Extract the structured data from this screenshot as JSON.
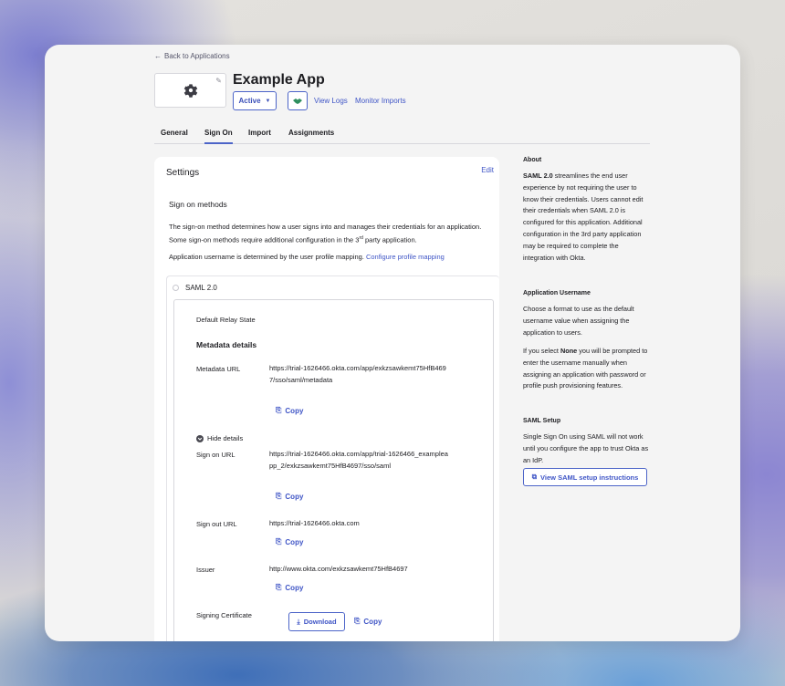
{
  "nav": {
    "back_label": "Back to Applications"
  },
  "app": {
    "title": "Example App",
    "status": "Active"
  },
  "header_links": {
    "view_logs": "View Logs",
    "monitor_imports": "Monitor Imports"
  },
  "tabs": [
    {
      "label": "General"
    },
    {
      "label": "Sign On",
      "active": true
    },
    {
      "label": "Import"
    },
    {
      "label": "Assignments"
    }
  ],
  "settings": {
    "title": "Settings",
    "edit_label": "Edit",
    "sign_on_heading": "Sign on methods",
    "para1_a": "The sign-on method determines how a user signs into and manages their credentials for an application. Some sign-on methods require additional configuration in the 3",
    "para1_sup": "rd",
    "para1_b": " party application.",
    "para2": "Application username is determined by the user profile mapping.",
    "para2_link": "Configure profile mapping",
    "saml_label": "SAML 2.0",
    "relay_state_label": "Default Relay State",
    "metadata_heading": "Metadata details",
    "metadata_url_label": "Metadata URL",
    "metadata_url": "https://trial-1626466.okta.com/app/exkzsawkemt75HfB4697/sso/saml/metadata",
    "copy_label": "Copy",
    "hide_details": "Hide details",
    "sign_on_url_label": "Sign on URL",
    "sign_on_url": "https://trial-1626466.okta.com/app/trial-1626466_exampleapp_2/exkzsawkemt75HfB4697/sso/saml",
    "sign_out_url_label": "Sign out URL",
    "sign_out_url": "https://trial-1626466.okta.com",
    "issuer_label": "Issuer",
    "issuer": "http://www.okta.com/exkzsawkemt75HfB4697",
    "signing_cert_label": "Signing Certificate",
    "download_label": "Download"
  },
  "sidebar": {
    "about_heading": "About",
    "about_bold": "SAML 2.0",
    "about_text": " streamlines the end user experience by not requiring the user to know their credentials. Users cannot edit their credentials when SAML 2.0 is configured for this application. Additional configuration in the 3rd party application may be required to complete the integration with Okta.",
    "username_heading": "Application Username",
    "username_text": "Choose a format to use as the default username value when assigning the application to users.",
    "none_prefix": "If you select ",
    "none_bold": "None",
    "none_text": " you will be prompted to enter the username manually when assigning an application with password or profile push provisioning features.",
    "setup_heading": "SAML Setup",
    "setup_text": "Single Sign On using SAML will not work until you configure the app to trust Okta as an IdP.",
    "setup_button": "View SAML setup instructions"
  },
  "colors": {
    "accent": "#3f55c6",
    "push_icon": "#2e8f5e"
  }
}
